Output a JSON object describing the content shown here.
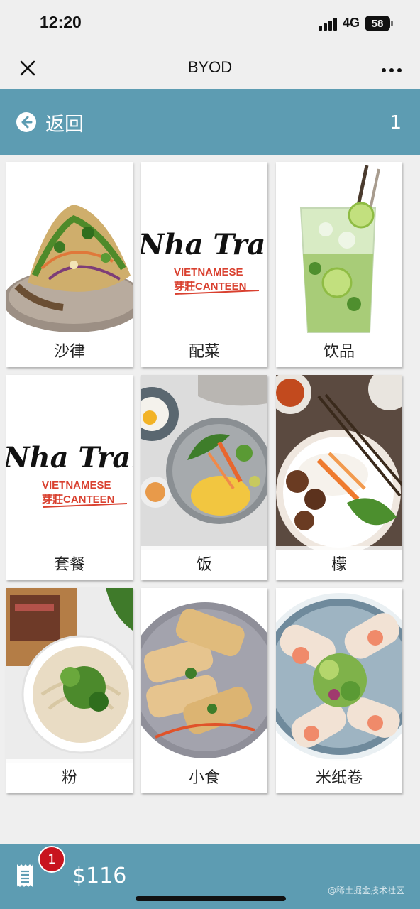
{
  "status_bar": {
    "time": "12:20",
    "network": "4G",
    "battery": "58",
    "signal_bars": 4
  },
  "nav": {
    "title": "BYOD",
    "close_icon": "close-icon",
    "more_icon": "more-horizontal-icon"
  },
  "back_bar": {
    "back_label": "返回",
    "back_icon": "arrow-left-circle-icon",
    "page_number": "1"
  },
  "categories": [
    {
      "label": "沙律",
      "image": "salad-photo"
    },
    {
      "label": "配菜",
      "image": "nha-trang-logo",
      "logo_script": "Nha Trang",
      "logo_line1": "VIETNAMESE",
      "logo_line2": "芽莊CANTEEN"
    },
    {
      "label": "饮品",
      "image": "mojito-drink-photo"
    },
    {
      "label": "套餐",
      "image": "nha-trang-logo",
      "logo_script": "Nha Trang",
      "logo_line1": "VIETNAMESE",
      "logo_line2": "芽莊CANTEEN"
    },
    {
      "label": "饭",
      "image": "rice-plate-photo"
    },
    {
      "label": "檬",
      "image": "vermicelli-bowl-photo"
    },
    {
      "label": "粉",
      "image": "pho-noodle-bowl-photo"
    },
    {
      "label": "小食",
      "image": "fried-snack-photo"
    },
    {
      "label": "米纸卷",
      "image": "rice-paper-roll-photo"
    }
  ],
  "cart": {
    "count": "1",
    "total": "$116",
    "receipt_icon": "receipt-icon"
  },
  "watermark": "@稀土掘金技术社区",
  "colors": {
    "accent": "#5d9cb2",
    "badge": "#c8141e",
    "logo_red": "#d9402f"
  }
}
